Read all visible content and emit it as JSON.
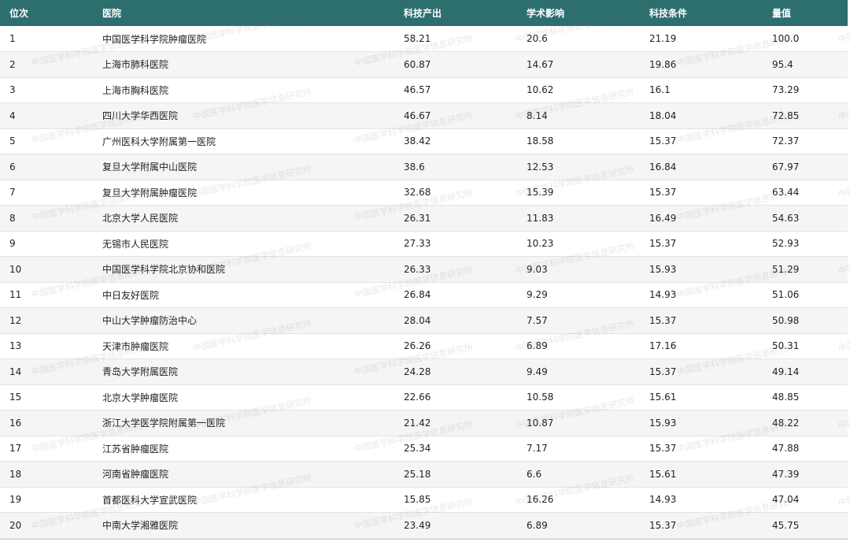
{
  "table": {
    "headers": [
      "位次",
      "医院",
      "科技产出",
      "学术影响",
      "科技条件",
      "量值"
    ],
    "rows": [
      {
        "rank": "1",
        "hospital": "中国医学科学院肿瘤医院",
        "sci_output": "58.21",
        "academic_impact": "20.6",
        "sci_condition": "21.19",
        "score": "100.0"
      },
      {
        "rank": "2",
        "hospital": "上海市肺科医院",
        "sci_output": "60.87",
        "academic_impact": "14.67",
        "sci_condition": "19.86",
        "score": "95.4"
      },
      {
        "rank": "3",
        "hospital": "上海市胸科医院",
        "sci_output": "46.57",
        "academic_impact": "10.62",
        "sci_condition": "16.1",
        "score": "73.29"
      },
      {
        "rank": "4",
        "hospital": "四川大学华西医院",
        "sci_output": "46.67",
        "academic_impact": "8.14",
        "sci_condition": "18.04",
        "score": "72.85"
      },
      {
        "rank": "5",
        "hospital": "广州医科大学附属第一医院",
        "sci_output": "38.42",
        "academic_impact": "18.58",
        "sci_condition": "15.37",
        "score": "72.37"
      },
      {
        "rank": "6",
        "hospital": "复旦大学附属中山医院",
        "sci_output": "38.6",
        "academic_impact": "12.53",
        "sci_condition": "16.84",
        "score": "67.97"
      },
      {
        "rank": "7",
        "hospital": "复旦大学附属肿瘤医院",
        "sci_output": "32.68",
        "academic_impact": "15.39",
        "sci_condition": "15.37",
        "score": "63.44"
      },
      {
        "rank": "8",
        "hospital": "北京大学人民医院",
        "sci_output": "26.31",
        "academic_impact": "11.83",
        "sci_condition": "16.49",
        "score": "54.63"
      },
      {
        "rank": "9",
        "hospital": "无锡市人民医院",
        "sci_output": "27.33",
        "academic_impact": "10.23",
        "sci_condition": "15.37",
        "score": "52.93"
      },
      {
        "rank": "10",
        "hospital": "中国医学科学院北京协和医院",
        "sci_output": "26.33",
        "academic_impact": "9.03",
        "sci_condition": "15.93",
        "score": "51.29"
      },
      {
        "rank": "11",
        "hospital": "中日友好医院",
        "sci_output": "26.84",
        "academic_impact": "9.29",
        "sci_condition": "14.93",
        "score": "51.06"
      },
      {
        "rank": "12",
        "hospital": "中山大学肿瘤防治中心",
        "sci_output": "28.04",
        "academic_impact": "7.57",
        "sci_condition": "15.37",
        "score": "50.98"
      },
      {
        "rank": "13",
        "hospital": "天津市肿瘤医院",
        "sci_output": "26.26",
        "academic_impact": "6.89",
        "sci_condition": "17.16",
        "score": "50.31"
      },
      {
        "rank": "14",
        "hospital": "青岛大学附属医院",
        "sci_output": "24.28",
        "academic_impact": "9.49",
        "sci_condition": "15.37",
        "score": "49.14"
      },
      {
        "rank": "15",
        "hospital": "北京大学肿瘤医院",
        "sci_output": "22.66",
        "academic_impact": "10.58",
        "sci_condition": "15.61",
        "score": "48.85"
      },
      {
        "rank": "16",
        "hospital": "浙江大学医学院附属第一医院",
        "sci_output": "21.42",
        "academic_impact": "10.87",
        "sci_condition": "15.93",
        "score": "48.22"
      },
      {
        "rank": "17",
        "hospital": "江苏省肿瘤医院",
        "sci_output": "25.34",
        "academic_impact": "7.17",
        "sci_condition": "15.37",
        "score": "47.88"
      },
      {
        "rank": "18",
        "hospital": "河南省肿瘤医院",
        "sci_output": "25.18",
        "academic_impact": "6.6",
        "sci_condition": "15.61",
        "score": "47.39"
      },
      {
        "rank": "19",
        "hospital": "首都医科大学宣武医院",
        "sci_output": "15.85",
        "academic_impact": "16.26",
        "sci_condition": "14.93",
        "score": "47.04"
      },
      {
        "rank": "20",
        "hospital": "中南大学湘雅医院",
        "sci_output": "23.49",
        "academic_impact": "6.89",
        "sci_condition": "15.37",
        "score": "45.75"
      }
    ]
  },
  "watermark": {
    "text": "中国医学科学院医学信息研究所"
  },
  "colors": {
    "header_bg": "#2d6e6f",
    "header_text": "#ffffff",
    "row_alt_bg": "#f5f5f5"
  }
}
